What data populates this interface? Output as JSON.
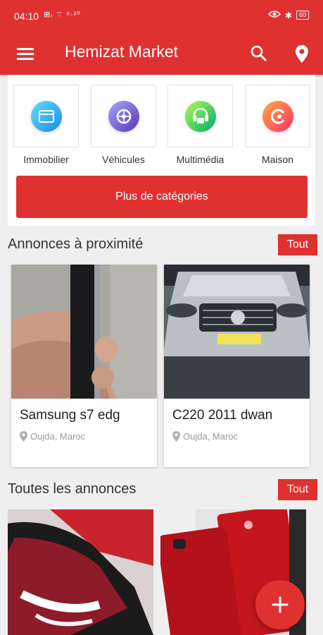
{
  "status_bar": {
    "time": "04:10",
    "left_icons": "⊞ᵢ ⌔ ⁸·²⁰",
    "bluetooth": "✱",
    "battery": "60"
  },
  "app_bar": {
    "title": "Hemizat Market",
    "menu_icon": "hamburger-menu-icon",
    "search_icon": "search-icon",
    "location_icon": "location-pin-icon"
  },
  "colors": {
    "primary": "#e03131",
    "background": "#efefef"
  },
  "categories": [
    {
      "label": "Immobilier",
      "icon": "building-icon"
    },
    {
      "label": "Véhicules",
      "icon": "car-wheel-icon"
    },
    {
      "label": "Multimédia",
      "icon": "multimedia-icon"
    },
    {
      "label": "Maison",
      "icon": "home-icon"
    }
  ],
  "more_categories_label": "Plus de catégories",
  "nearby": {
    "title": "Annonces à proximité",
    "see_all_label": "Tout",
    "items": [
      {
        "title": "Samsung s7 edg",
        "location": "Oujda, Maroc"
      },
      {
        "title": "C220 2011 dwan",
        "location": "Oujda, Maroc"
      }
    ]
  },
  "all_ads": {
    "title": "Toutes les annonces",
    "see_all_label": "Tout"
  },
  "fab_icon": "plus-icon"
}
